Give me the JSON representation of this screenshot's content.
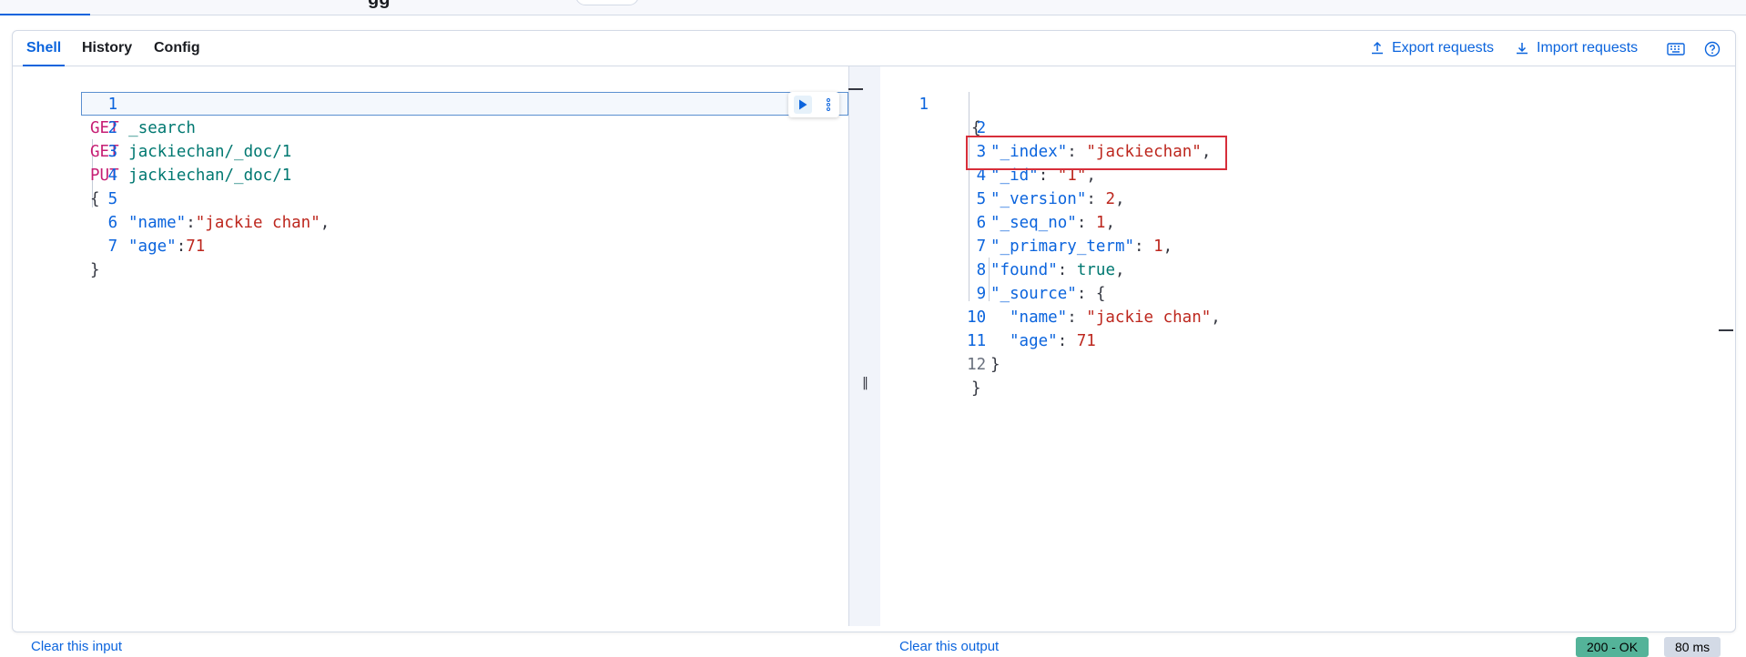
{
  "header": {
    "cut_title": "gg",
    "pill_label": ""
  },
  "tabs": [
    {
      "label": "Shell",
      "active": true
    },
    {
      "label": "History",
      "active": false
    },
    {
      "label": "Config",
      "active": false
    }
  ],
  "actions": {
    "export_label": "Export requests",
    "import_label": "Import requests"
  },
  "input_editor": {
    "lines": [
      {
        "n": "1",
        "method": "GET",
        "path": "_search"
      },
      {
        "n": "2",
        "method": "GET",
        "path": "jackiechan/_doc/1"
      },
      {
        "n": "3",
        "method": "PUT",
        "path": "jackiechan/_doc/1"
      },
      {
        "n": "4",
        "text": "{"
      },
      {
        "n": "5",
        "key": "\"name\"",
        "sep": ":",
        "value": "\"jackie chan\"",
        "tail": ","
      },
      {
        "n": "6",
        "key": "\"age\"",
        "sep": ":",
        "value": "71"
      },
      {
        "n": "7",
        "text": "}"
      }
    ]
  },
  "output_editor": {
    "lines": [
      {
        "n": "1",
        "text": "{"
      },
      {
        "n": "2",
        "key": "\"_index\"",
        "value": "\"jackiechan\"",
        "tail": ","
      },
      {
        "n": "3",
        "key": "\"_id\"",
        "value": "\"1\"",
        "tail": ","
      },
      {
        "n": "4",
        "key": "\"_version\"",
        "value": "2",
        "tail": ","
      },
      {
        "n": "5",
        "key": "\"_seq_no\"",
        "value": "1",
        "tail": ","
      },
      {
        "n": "6",
        "key": "\"_primary_term\"",
        "value": "1",
        "tail": ","
      },
      {
        "n": "7",
        "key": "\"found\"",
        "value": "true",
        "tail": ","
      },
      {
        "n": "8",
        "key": "\"_source\"",
        "value": "{",
        "tail": ""
      },
      {
        "n": "9",
        "key": "\"name\"",
        "value": "\"jackie chan\"",
        "tail": ","
      },
      {
        "n": "10",
        "key": "\"age\"",
        "value": "71",
        "tail": ""
      },
      {
        "n": "11",
        "text": "}"
      },
      {
        "n": "12",
        "text": "}"
      }
    ]
  },
  "footer": {
    "clear_input": "Clear this input",
    "clear_output": "Clear this output",
    "status": "200 - OK",
    "time": "80 ms"
  },
  "colors": {
    "accent": "#0b64dd",
    "highlight": "#d72e3a",
    "status_bg": "#54b399",
    "time_bg": "#d3dae6"
  }
}
